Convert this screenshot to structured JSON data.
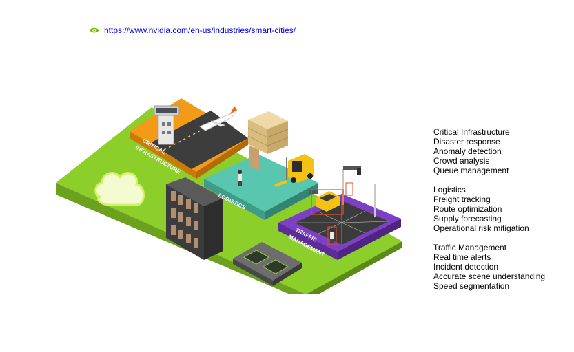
{
  "link": {
    "icon": "nvidia-logo-icon",
    "url": "https://www.nvidia.com/en-us/industries/smart-cities/"
  },
  "illustration": {
    "labels": {
      "critical_1": "CRITICAL",
      "critical_2": "INFRASTRUCTURE",
      "logistics": "LOGISTICS",
      "traffic_1": "TRAFFIC",
      "traffic_2": "MANAGEMENT"
    },
    "colors": {
      "base_green": "#8ccf2a",
      "critical_orange": "#f39a16",
      "logistics_teal": "#59c7b0",
      "traffic_purple": "#7d3fc3",
      "runway": "#3d3d3d"
    }
  },
  "use_cases": [
    {
      "title": "Critical Infrastructure",
      "items": [
        "Disaster response",
        "Anomaly detection",
        "Crowd analysis",
        "Queue management"
      ]
    },
    {
      "title": "Logistics",
      "items": [
        "Freight tracking",
        "Route optimization",
        "Supply forecasting",
        "Operational risk mitigation"
      ]
    },
    {
      "title": "Traffic Management",
      "items": [
        "Real time alerts",
        "Incident detection",
        "Accurate scene understanding",
        "Speed segmentation"
      ]
    }
  ]
}
